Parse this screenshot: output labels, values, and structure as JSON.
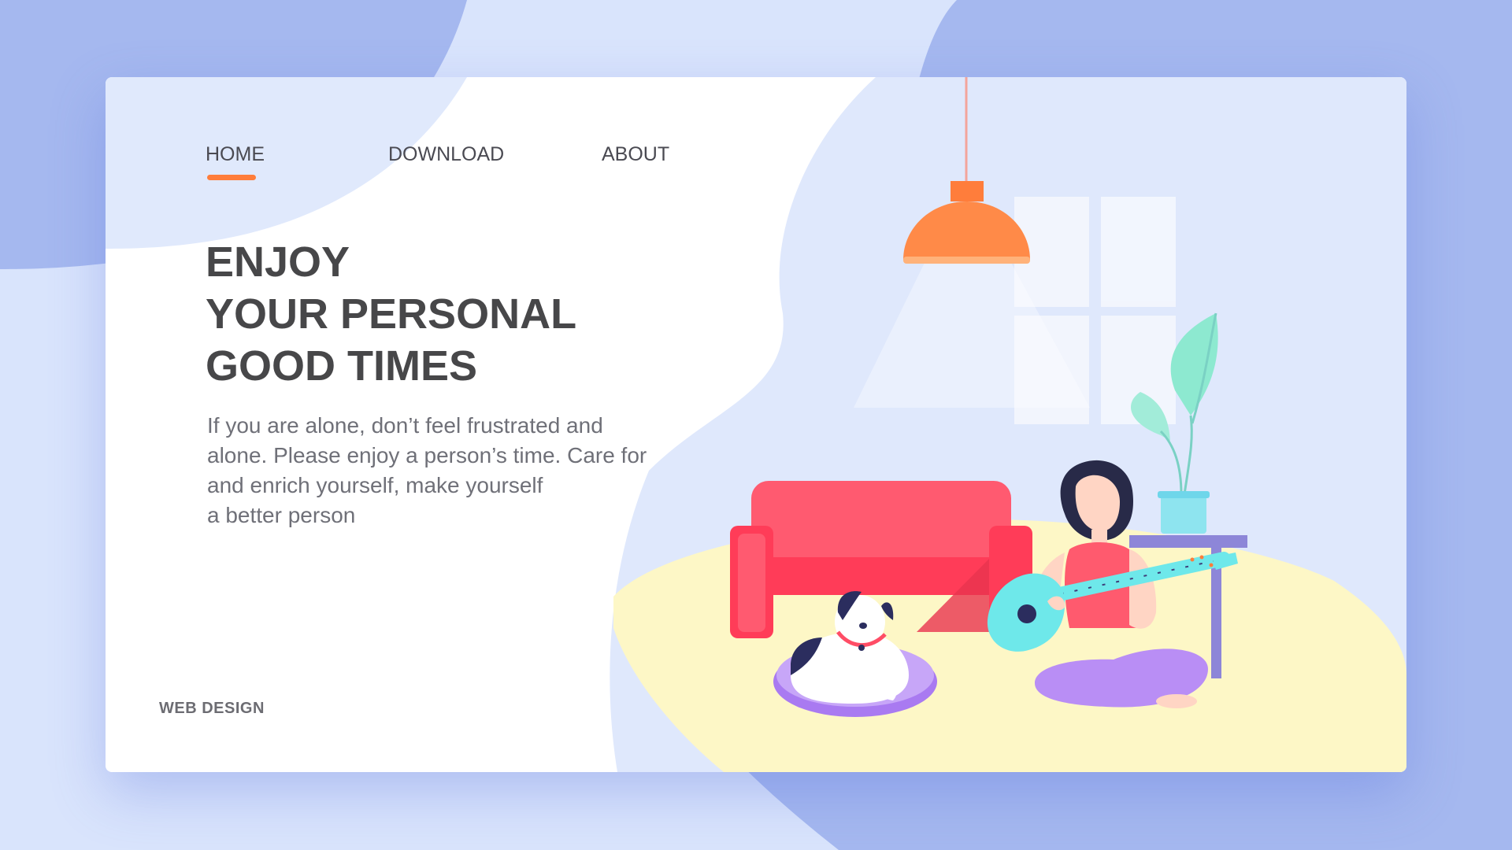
{
  "nav": {
    "items": [
      {
        "label": "HOME",
        "active": true
      },
      {
        "label": "DOWNLOAD",
        "active": false
      },
      {
        "label": "ABOUT",
        "active": false
      }
    ]
  },
  "hero": {
    "headline": [
      "ENJOY",
      "YOUR PERSONAL",
      "GOOD TIMES"
    ],
    "description": [
      "If you are alone, don’t feel frustrated and",
      "alone. Please enjoy a person’s time. Care for",
      "and enrich yourself, make yourself",
      "a better person"
    ]
  },
  "footer": {
    "label": "WEB DESIGN"
  },
  "illustration": {
    "subject": "woman playing guitar beside a sofa, a dog on a cushion, a hanging lamp, a window and a potted plant"
  },
  "colors": {
    "accent": "#ff7d3b",
    "background": "#d9e4fc",
    "blob": "#a5b8ef",
    "panel": "#dfe8fc",
    "floor": "#fdf7c6",
    "sofa": "#ff4d66",
    "guitar": "#6ee8ea",
    "pants": "#b98ef5",
    "text_dark": "#474749",
    "text_light": "#6f7078"
  }
}
